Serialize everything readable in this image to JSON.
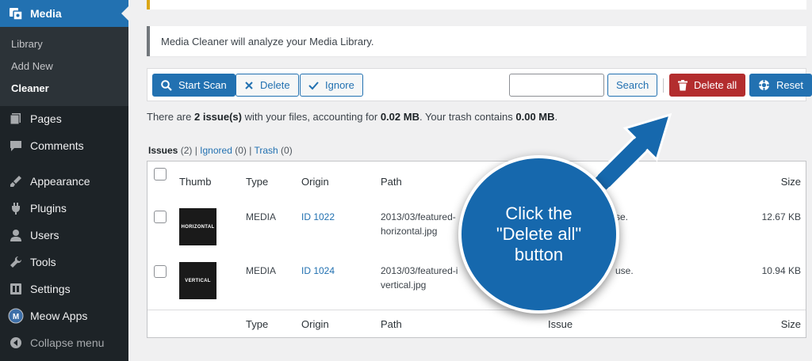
{
  "sidebar": {
    "media_label": "Media",
    "submenu": [
      {
        "label": "Library"
      },
      {
        "label": "Add New"
      },
      {
        "label": "Cleaner"
      }
    ],
    "items": [
      {
        "label": "Pages",
        "icon": "pages-icon"
      },
      {
        "label": "Comments",
        "icon": "comments-icon"
      },
      {
        "label": "Appearance",
        "icon": "appearance-icon"
      },
      {
        "label": "Plugins",
        "icon": "plugins-icon"
      },
      {
        "label": "Users",
        "icon": "users-icon"
      },
      {
        "label": "Tools",
        "icon": "tools-icon"
      },
      {
        "label": "Settings",
        "icon": "settings-icon"
      },
      {
        "label": "Meow Apps",
        "icon": "meow-apps-icon"
      },
      {
        "label": "Collapse menu",
        "icon": "collapse-icon"
      }
    ]
  },
  "notice": {
    "text": "Media Cleaner will analyze your Media Library."
  },
  "toolbar": {
    "start_scan": "Start Scan",
    "delete": "Delete",
    "ignore": "Ignore",
    "search_value": "",
    "search_button": "Search",
    "delete_all": "Delete all",
    "reset": "Reset"
  },
  "summary": {
    "prefix": "There are ",
    "count": "2 issue(s)",
    "mid": " with your files, accounting for ",
    "size": "0.02 MB",
    "mid2": ". Your trash contains ",
    "trash": "0.00 MB",
    "suffix": "."
  },
  "filters": {
    "issues": "Issues",
    "issues_count": "(2)",
    "ignored": "Ignored",
    "ignored_count": "(0)",
    "trash": "Trash",
    "trash_count": "(0)"
  },
  "table": {
    "headers": {
      "thumb": "Thumb",
      "type": "Type",
      "origin": "Origin",
      "path": "Path",
      "issue": "Issue",
      "size": "Size"
    },
    "rows": [
      {
        "thumb_text": "HORIZONTAL",
        "type": "MEDIA",
        "origin": "ID 1022",
        "path1": "2013/03/featured-",
        "path2": "horizontal.jpg",
        "issue": "se.",
        "size": "12.67 KB"
      },
      {
        "thumb_text": "VERTICAL",
        "type": "MEDIA",
        "origin": "ID 1024",
        "path1": "2013/03/featured-i",
        "path2": "vertical.jpg",
        "issue": "use.",
        "size": "10.94 KB"
      }
    ]
  },
  "callout": {
    "line1": "Click the",
    "line2": "\"Delete all\"",
    "line3": "button"
  },
  "colors": {
    "accent": "#2271b1",
    "danger": "#b32d2e",
    "callout": "#1668ad",
    "sidebar": "#1d2327"
  }
}
